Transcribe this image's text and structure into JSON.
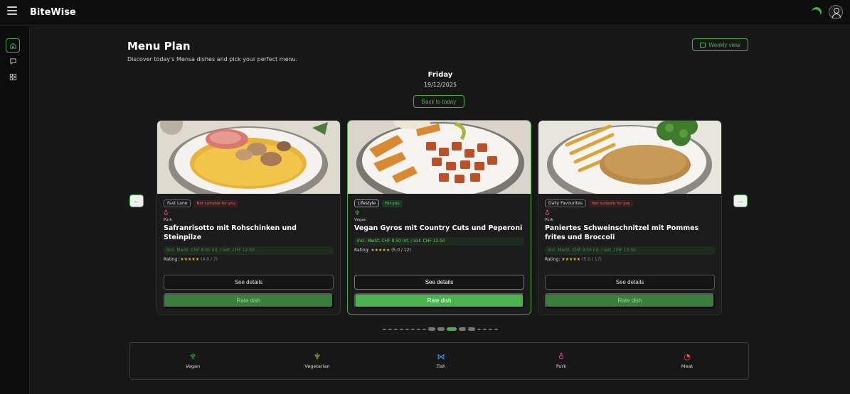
{
  "app": {
    "name": "BiteWise"
  },
  "header": {
    "title": "Menu Plan",
    "subtitle": "Discover today's Mensa dishes and pick your perfect menu.",
    "weekly_view_label": "Weekly view"
  },
  "date": {
    "day": "Friday",
    "date": "19/12/2025",
    "back_label": "Back to today"
  },
  "nav": {
    "prev": "←",
    "next": "→"
  },
  "cards": [
    {
      "category": "Fast Lane",
      "badge": "Not suitable for you",
      "diet": "Pork",
      "title": "Safranrisotto mit Rohschinken und Steinpilze",
      "price": "Incl. MwSt. CHF 8.00 int. / ext. CHF 12.50",
      "rating_prefix": "Rating:",
      "stars": "★★★★★",
      "rating_value": "(4.0 / 7)",
      "details_label": "See details",
      "rate_label": "Rate dish"
    },
    {
      "category": "Lifestyle",
      "badge": "For you",
      "diet": "Vegan",
      "title": "Vegan Gyros mit Country Cuts und Peperoni",
      "price": "Incl. MwSt. CHF 8.50 int. / ext. CHF 12.50",
      "rating_prefix": "Rating:",
      "stars": "★★★★★",
      "rating_value": "(5.0 / 12)",
      "details_label": "See details",
      "rate_label": "Rate dish"
    },
    {
      "category": "Daily Favourites",
      "badge": "Not suitable for you",
      "diet": "Pork",
      "title": "Paniertes Schweinschnitzel mit Pommes frites und Broccoli",
      "price": "Incl. MwSt. CHF 9.50 int. / ext. CHF 13.50",
      "rating_prefix": "Rating:",
      "stars": "★★★★★",
      "rating_value": "(5.0 / 17)",
      "details_label": "See details",
      "rate_label": "Rate dish"
    }
  ],
  "legend": [
    {
      "label": "Vegan",
      "icon": "leaf-icon",
      "color": "#4caf50"
    },
    {
      "label": "Vegetarian",
      "icon": "leaf-icon",
      "color": "#a4c639"
    },
    {
      "label": "Fish",
      "icon": "fish-icon",
      "color": "#42a5f5"
    },
    {
      "label": "Pork",
      "icon": "pig-icon",
      "color": "#ec4f9b"
    },
    {
      "label": "Meat",
      "icon": "meat-icon",
      "color": "#ef5350"
    }
  ],
  "colors": {
    "accent": "#49b04d",
    "background": "#181818"
  }
}
